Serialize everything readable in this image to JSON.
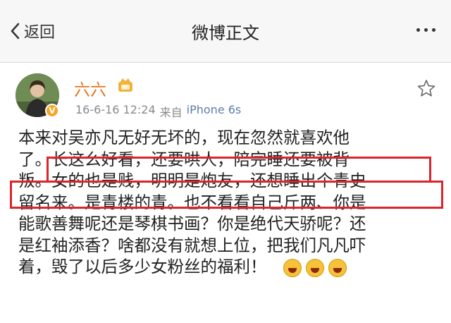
{
  "nav": {
    "back_label": "返回",
    "title": "微博正文"
  },
  "user": {
    "name": "六六",
    "verified_badge": "V",
    "timestamp": "16-6-16 12:24",
    "source_prefix": "来自",
    "device": "iPhone 6s"
  },
  "post": {
    "lines": [
      "本来对吴亦凡无好无坏的，现在忽然就喜欢他",
      "了。长这么好看，还要哄人，陪完睡还要被背",
      "叛。女的也是贱，明明是炮友，还想睡出个青史",
      "留名来。是青楼的青。也不看看自己斤两、你是",
      "能歌善舞呢还是琴棋书画？你是绝代天骄呢？还",
      "是红袖添香？啥都没有就想上位，把我们凡凡吓",
      "着，毁了以后多少女粉丝的福利！"
    ],
    "emojis": [
      "laughing-emoji",
      "laughing-emoji",
      "laughing-emoji"
    ]
  },
  "colors": {
    "username": "#e8731c",
    "highlight_box": "#d9252b",
    "device_link": "#5b7dad"
  }
}
